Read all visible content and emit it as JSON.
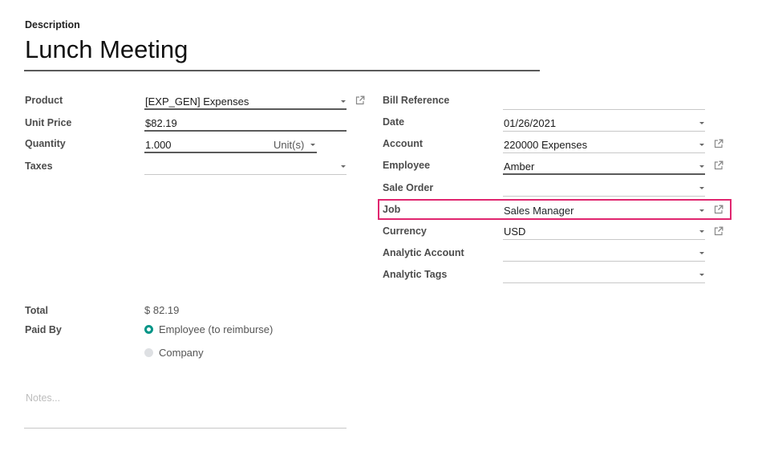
{
  "description": {
    "label": "Description",
    "value": "Lunch Meeting"
  },
  "left_fields": {
    "product": {
      "label": "Product",
      "value": "[EXP_GEN] Expenses"
    },
    "unit_price": {
      "label": "Unit Price",
      "value": "$82.19"
    },
    "quantity": {
      "label": "Quantity",
      "value": "1.000",
      "uom": "Unit(s)"
    },
    "taxes": {
      "label": "Taxes",
      "value": ""
    }
  },
  "right_fields": {
    "bill_reference": {
      "label": "Bill Reference",
      "value": ""
    },
    "date": {
      "label": "Date",
      "value": "01/26/2021"
    },
    "account": {
      "label": "Account",
      "value": "220000 Expenses"
    },
    "employee": {
      "label": "Employee",
      "value": "Amber"
    },
    "sale_order": {
      "label": "Sale Order",
      "value": ""
    },
    "job": {
      "label": "Job",
      "value": "Sales Manager"
    },
    "currency": {
      "label": "Currency",
      "value": "USD"
    },
    "analytic_account": {
      "label": "Analytic Account",
      "value": ""
    },
    "analytic_tags": {
      "label": "Analytic Tags",
      "value": ""
    }
  },
  "total": {
    "label": "Total",
    "value": "$ 82.19"
  },
  "paid_by": {
    "label": "Paid By",
    "options": [
      {
        "label": "Employee (to reimburse)",
        "selected": true
      },
      {
        "label": "Company",
        "selected": false
      }
    ]
  },
  "notes": {
    "placeholder": "Notes..."
  },
  "colors": {
    "highlight": "#e0266f",
    "radio_selected": "#019587"
  }
}
